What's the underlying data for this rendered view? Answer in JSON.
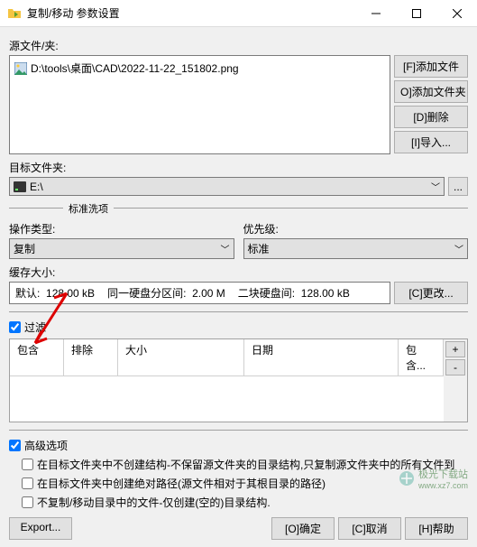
{
  "window": {
    "title": "复制/移动 参数设置"
  },
  "source": {
    "label": "源文件/夹:",
    "items": [
      "D:\\tools\\桌面\\CAD\\2022-11-22_151802.png"
    ]
  },
  "side_buttons": {
    "add_file": "[F]添加文件",
    "add_folder": "O]添加文件夹",
    "delete": "[D]删除",
    "import": "[I]导入..."
  },
  "dest": {
    "label": "目标文件夹:",
    "value": "E:\\",
    "browse": "..."
  },
  "std_section": "标准洗项",
  "op_type": {
    "label": "操作类型:",
    "value": "复制"
  },
  "priority": {
    "label": "优先级:",
    "value": "标准"
  },
  "cache": {
    "label": "缓存大小:",
    "default_label": "默认:",
    "default_value": "128.00 kB",
    "same_label": "同一硬盘分区间:",
    "same_value": "2.00 M",
    "diff_label": "二块硬盘间:",
    "diff_value": "128.00 kB",
    "change": "[C]更改..."
  },
  "filter": {
    "checkbox": "过滤",
    "cols": {
      "include": "包含",
      "exclude": "排除",
      "size": "大小",
      "date": "日期",
      "include2": "包含..."
    }
  },
  "advanced": {
    "checkbox": "高级选项",
    "opt1": "在目标文件夹中不创建结构-不保留源文件夹的目录结构,只复制源文件夹中的所有文件到",
    "opt2": "在目标文件夹中创建绝对路径(源文件相对于其根目录的路径)",
    "opt3": "不复制/移动目录中的文件-仅创建(空的)目录结构."
  },
  "footer": {
    "export": "Export...",
    "ok": "[O]确定",
    "cancel": "[C]取消",
    "help": "[H]帮助"
  },
  "watermark": {
    "text": "极光下载站",
    "url": "www.xz7.com"
  }
}
